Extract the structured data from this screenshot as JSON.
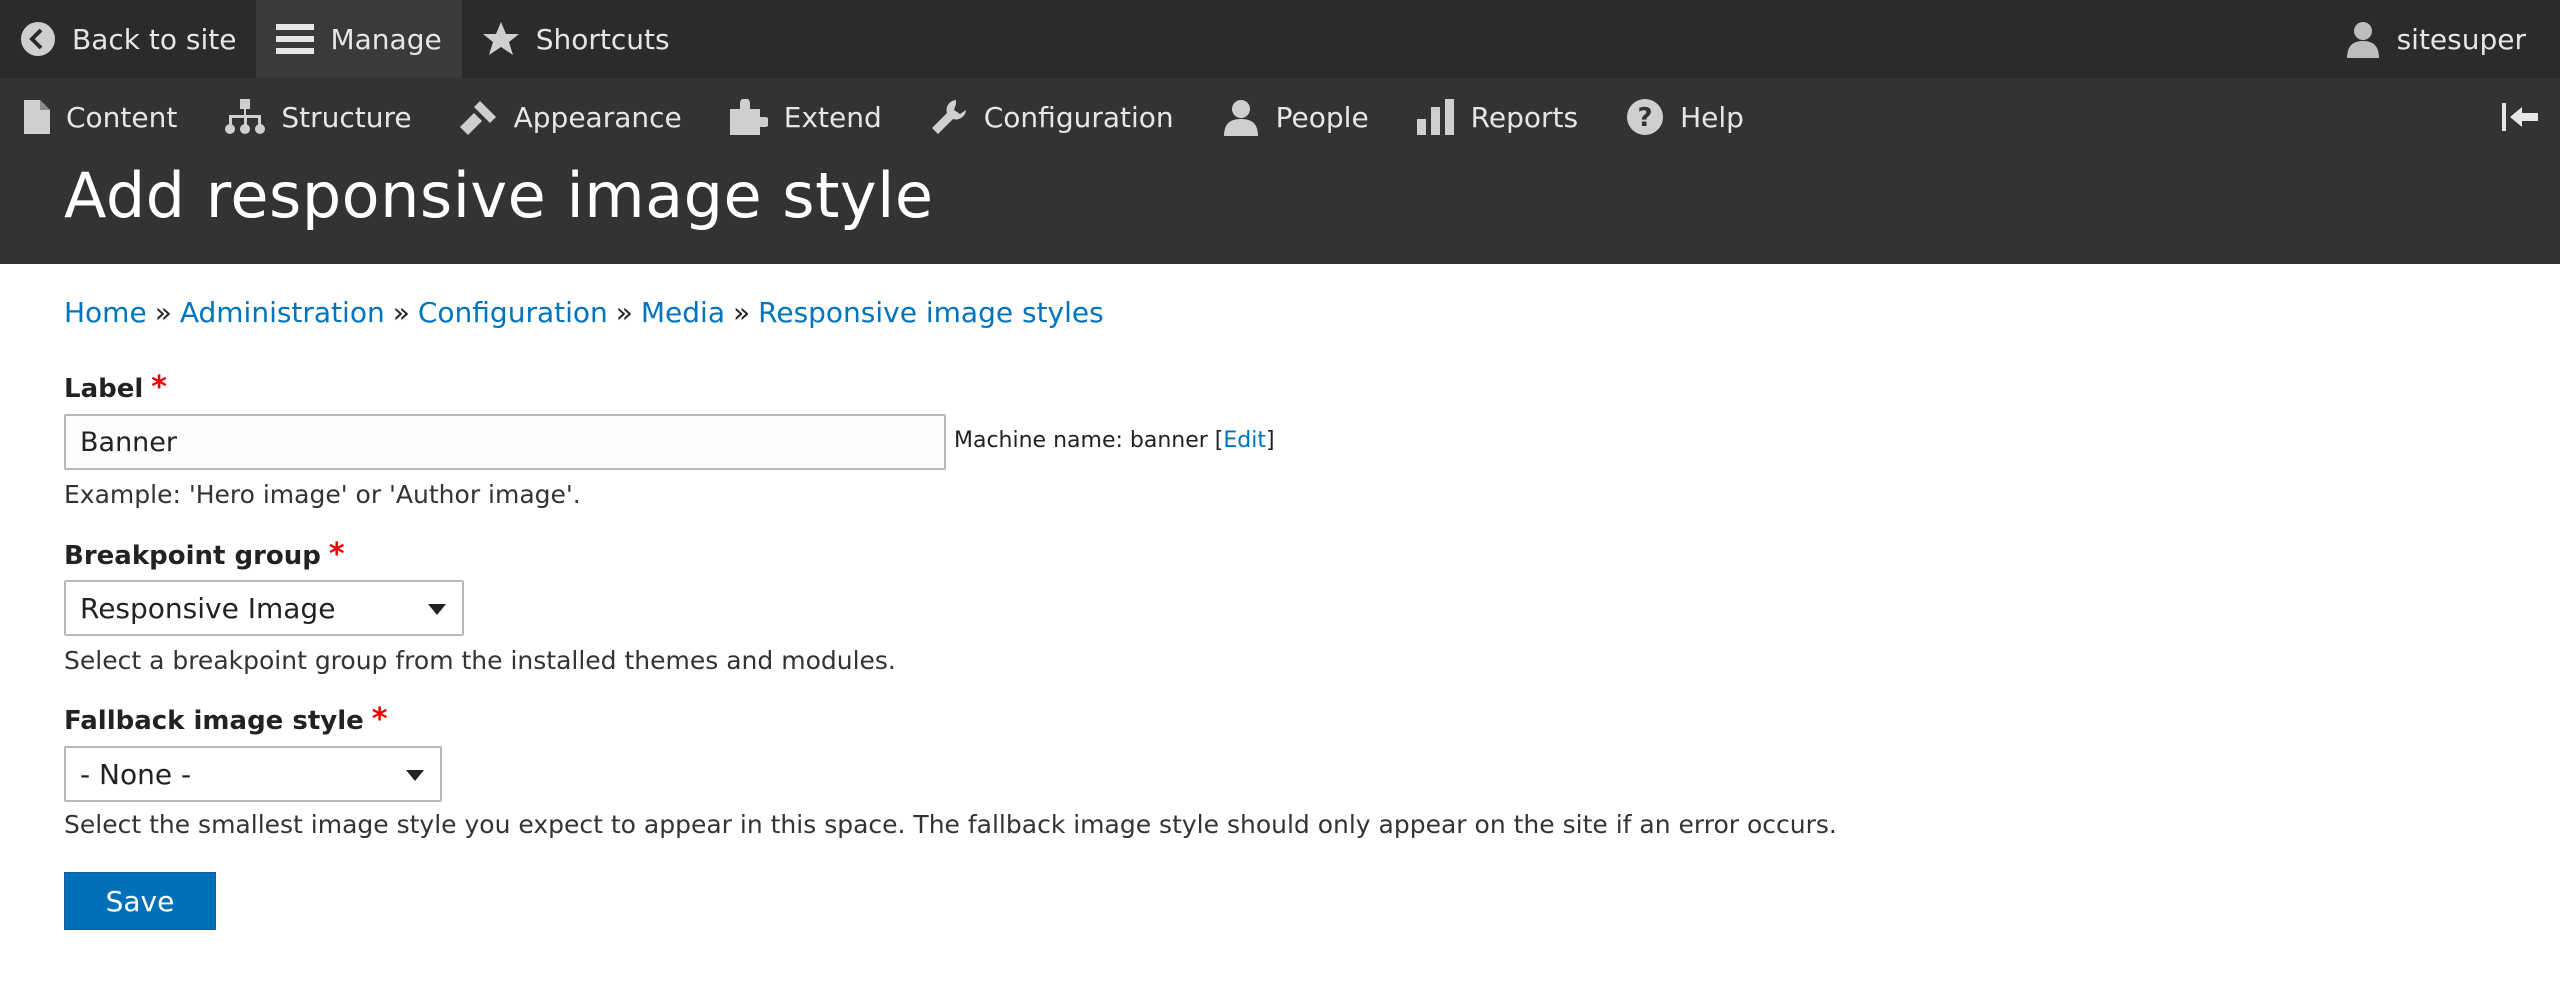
{
  "toolbar": {
    "back_label": "Back to site",
    "manage_label": "Manage",
    "shortcuts_label": "Shortcuts",
    "user_label": "sitesuper"
  },
  "tray": {
    "items": [
      {
        "label": "Content",
        "icon": "document-icon"
      },
      {
        "label": "Structure",
        "icon": "sitemap-icon"
      },
      {
        "label": "Appearance",
        "icon": "paintbrush-icon"
      },
      {
        "label": "Extend",
        "icon": "puzzle-icon"
      },
      {
        "label": "Configuration",
        "icon": "wrench-icon"
      },
      {
        "label": "People",
        "icon": "person-icon"
      },
      {
        "label": "Reports",
        "icon": "bar-chart-icon"
      },
      {
        "label": "Help",
        "icon": "help-icon"
      }
    ]
  },
  "page": {
    "title": "Add responsive image style"
  },
  "breadcrumb": {
    "items": [
      "Home",
      "Administration",
      "Configuration",
      "Media",
      "Responsive image styles"
    ],
    "separator": "»"
  },
  "form": {
    "label_field": {
      "label": "Label",
      "required_marker": "*",
      "value": "Banner",
      "machine_name_prefix": "Machine name: banner [",
      "machine_name_edit": "Edit",
      "machine_name_suffix": "]",
      "description": "Example: 'Hero image' or 'Author image'."
    },
    "breakpoint_group": {
      "label": "Breakpoint group",
      "required_marker": "*",
      "selected": "Responsive Image",
      "description": "Select a breakpoint group from the installed themes and modules."
    },
    "fallback_style": {
      "label": "Fallback image style",
      "required_marker": "*",
      "selected": "- None -",
      "description": "Select the smallest image style you expect to appear in this space. The fallback image style should only appear on the site if an error occurs."
    },
    "save_label": "Save"
  },
  "colors": {
    "toolbar_bg": "#2b2b2b",
    "header_bg": "#333333",
    "link": "#0074bd",
    "button": "#0071b8",
    "required": "#e00000"
  }
}
